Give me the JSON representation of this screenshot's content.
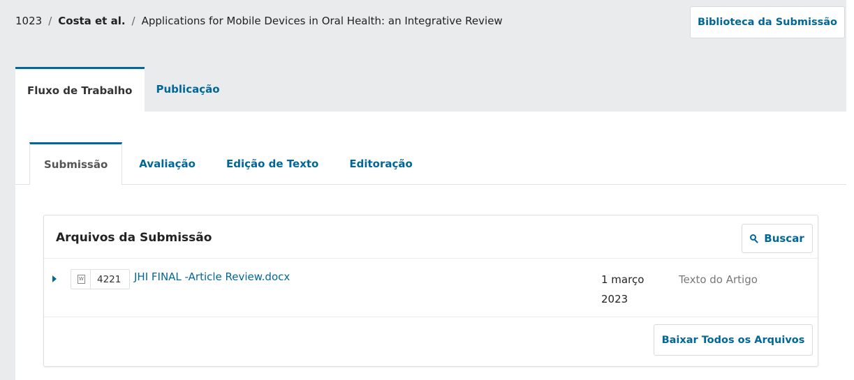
{
  "breadcrumb": {
    "id": "1023",
    "separator": "/",
    "authors": "Costa et al.",
    "title": "Applications for Mobile Devices in Oral Health: an Integrative Review"
  },
  "header": {
    "library_button": "Biblioteca da Submissão"
  },
  "main_tabs": [
    {
      "label": "Fluxo de Trabalho",
      "active": true
    },
    {
      "label": "Publicação",
      "active": false
    }
  ],
  "sub_tabs": [
    {
      "label": "Submissão",
      "active": true
    },
    {
      "label": "Avaliação",
      "active": false
    },
    {
      "label": "Edição de Texto",
      "active": false
    },
    {
      "label": "Editoração",
      "active": false
    }
  ],
  "files_panel": {
    "title": "Arquivos da Submissão",
    "search_label": "Buscar",
    "download_all_label": "Baixar Todos os Arquivos",
    "files": [
      {
        "id": "4221",
        "icon": "word-doc-icon",
        "name": "JHI FINAL -Article Review.docx",
        "date": "1 março 2023",
        "type": "Texto do Artigo"
      }
    ]
  },
  "colors": {
    "accent": "#006798",
    "page_bg": "#e9ebed",
    "panel_bg": "#ffffff"
  }
}
